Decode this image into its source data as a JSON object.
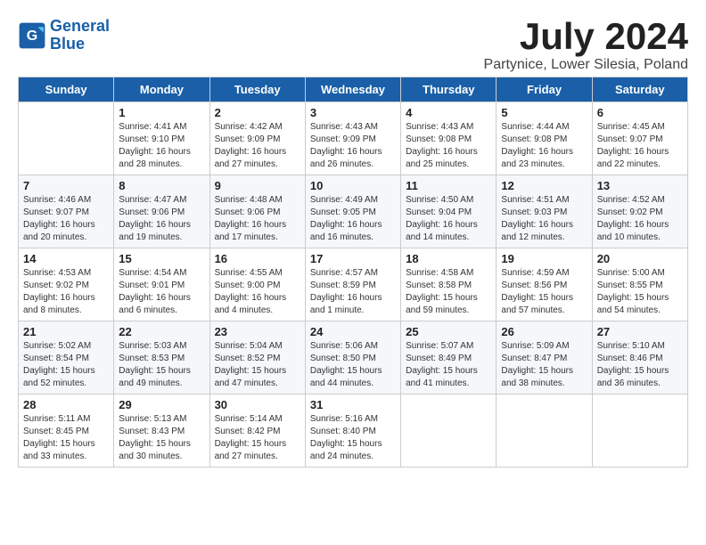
{
  "logo": {
    "line1": "General",
    "line2": "Blue"
  },
  "title": "July 2024",
  "location": "Partynice, Lower Silesia, Poland",
  "days_of_week": [
    "Sunday",
    "Monday",
    "Tuesday",
    "Wednesday",
    "Thursday",
    "Friday",
    "Saturday"
  ],
  "weeks": [
    [
      {
        "num": "",
        "info": ""
      },
      {
        "num": "1",
        "info": "Sunrise: 4:41 AM\nSunset: 9:10 PM\nDaylight: 16 hours\nand 28 minutes."
      },
      {
        "num": "2",
        "info": "Sunrise: 4:42 AM\nSunset: 9:09 PM\nDaylight: 16 hours\nand 27 minutes."
      },
      {
        "num": "3",
        "info": "Sunrise: 4:43 AM\nSunset: 9:09 PM\nDaylight: 16 hours\nand 26 minutes."
      },
      {
        "num": "4",
        "info": "Sunrise: 4:43 AM\nSunset: 9:08 PM\nDaylight: 16 hours\nand 25 minutes."
      },
      {
        "num": "5",
        "info": "Sunrise: 4:44 AM\nSunset: 9:08 PM\nDaylight: 16 hours\nand 23 minutes."
      },
      {
        "num": "6",
        "info": "Sunrise: 4:45 AM\nSunset: 9:07 PM\nDaylight: 16 hours\nand 22 minutes."
      }
    ],
    [
      {
        "num": "7",
        "info": "Sunrise: 4:46 AM\nSunset: 9:07 PM\nDaylight: 16 hours\nand 20 minutes."
      },
      {
        "num": "8",
        "info": "Sunrise: 4:47 AM\nSunset: 9:06 PM\nDaylight: 16 hours\nand 19 minutes."
      },
      {
        "num": "9",
        "info": "Sunrise: 4:48 AM\nSunset: 9:06 PM\nDaylight: 16 hours\nand 17 minutes."
      },
      {
        "num": "10",
        "info": "Sunrise: 4:49 AM\nSunset: 9:05 PM\nDaylight: 16 hours\nand 16 minutes."
      },
      {
        "num": "11",
        "info": "Sunrise: 4:50 AM\nSunset: 9:04 PM\nDaylight: 16 hours\nand 14 minutes."
      },
      {
        "num": "12",
        "info": "Sunrise: 4:51 AM\nSunset: 9:03 PM\nDaylight: 16 hours\nand 12 minutes."
      },
      {
        "num": "13",
        "info": "Sunrise: 4:52 AM\nSunset: 9:02 PM\nDaylight: 16 hours\nand 10 minutes."
      }
    ],
    [
      {
        "num": "14",
        "info": "Sunrise: 4:53 AM\nSunset: 9:02 PM\nDaylight: 16 hours\nand 8 minutes."
      },
      {
        "num": "15",
        "info": "Sunrise: 4:54 AM\nSunset: 9:01 PM\nDaylight: 16 hours\nand 6 minutes."
      },
      {
        "num": "16",
        "info": "Sunrise: 4:55 AM\nSunset: 9:00 PM\nDaylight: 16 hours\nand 4 minutes."
      },
      {
        "num": "17",
        "info": "Sunrise: 4:57 AM\nSunset: 8:59 PM\nDaylight: 16 hours\nand 1 minute."
      },
      {
        "num": "18",
        "info": "Sunrise: 4:58 AM\nSunset: 8:58 PM\nDaylight: 15 hours\nand 59 minutes."
      },
      {
        "num": "19",
        "info": "Sunrise: 4:59 AM\nSunset: 8:56 PM\nDaylight: 15 hours\nand 57 minutes."
      },
      {
        "num": "20",
        "info": "Sunrise: 5:00 AM\nSunset: 8:55 PM\nDaylight: 15 hours\nand 54 minutes."
      }
    ],
    [
      {
        "num": "21",
        "info": "Sunrise: 5:02 AM\nSunset: 8:54 PM\nDaylight: 15 hours\nand 52 minutes."
      },
      {
        "num": "22",
        "info": "Sunrise: 5:03 AM\nSunset: 8:53 PM\nDaylight: 15 hours\nand 49 minutes."
      },
      {
        "num": "23",
        "info": "Sunrise: 5:04 AM\nSunset: 8:52 PM\nDaylight: 15 hours\nand 47 minutes."
      },
      {
        "num": "24",
        "info": "Sunrise: 5:06 AM\nSunset: 8:50 PM\nDaylight: 15 hours\nand 44 minutes."
      },
      {
        "num": "25",
        "info": "Sunrise: 5:07 AM\nSunset: 8:49 PM\nDaylight: 15 hours\nand 41 minutes."
      },
      {
        "num": "26",
        "info": "Sunrise: 5:09 AM\nSunset: 8:47 PM\nDaylight: 15 hours\nand 38 minutes."
      },
      {
        "num": "27",
        "info": "Sunrise: 5:10 AM\nSunset: 8:46 PM\nDaylight: 15 hours\nand 36 minutes."
      }
    ],
    [
      {
        "num": "28",
        "info": "Sunrise: 5:11 AM\nSunset: 8:45 PM\nDaylight: 15 hours\nand 33 minutes."
      },
      {
        "num": "29",
        "info": "Sunrise: 5:13 AM\nSunset: 8:43 PM\nDaylight: 15 hours\nand 30 minutes."
      },
      {
        "num": "30",
        "info": "Sunrise: 5:14 AM\nSunset: 8:42 PM\nDaylight: 15 hours\nand 27 minutes."
      },
      {
        "num": "31",
        "info": "Sunrise: 5:16 AM\nSunset: 8:40 PM\nDaylight: 15 hours\nand 24 minutes."
      },
      {
        "num": "",
        "info": ""
      },
      {
        "num": "",
        "info": ""
      },
      {
        "num": "",
        "info": ""
      }
    ]
  ]
}
